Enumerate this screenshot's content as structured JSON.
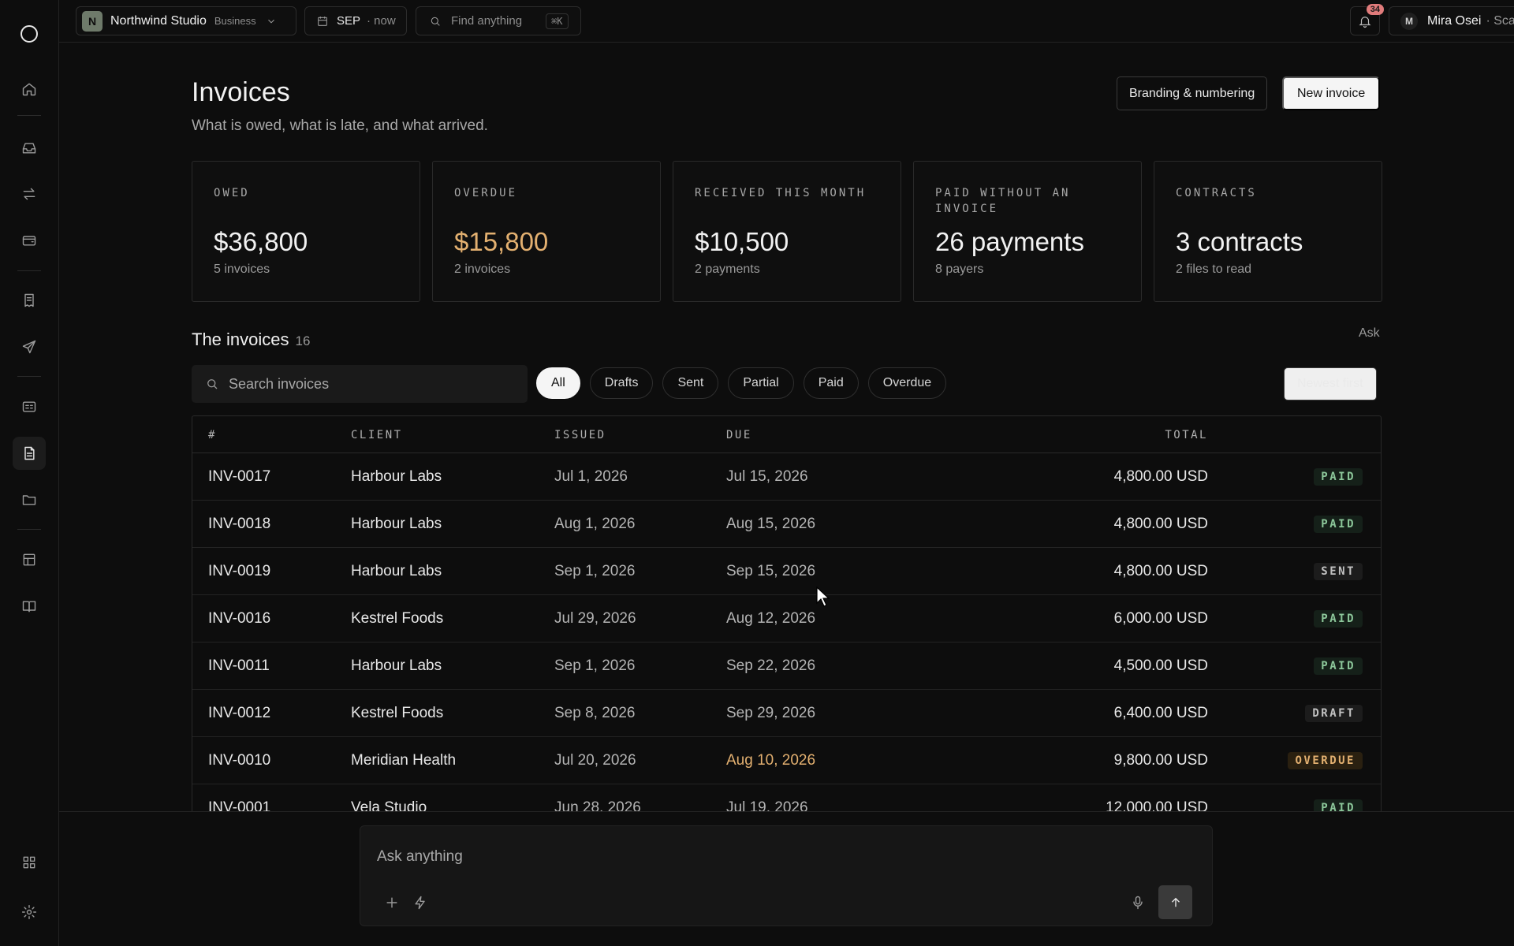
{
  "workspace": {
    "initial": "N",
    "name": "Northwind Studio",
    "plan": "Business"
  },
  "period": {
    "label": "SEP",
    "sub": "· now"
  },
  "find": {
    "placeholder": "Find anything",
    "shortcut": "⌘K"
  },
  "notifications": {
    "count": "34"
  },
  "user": {
    "initial": "M",
    "name": "Mira Osei",
    "plan": "· Scale"
  },
  "page": {
    "title": "Invoices",
    "subtitle": "What is owed, what is late, and what arrived."
  },
  "actions": {
    "branding_label": "Branding & numbering",
    "new_label": "New invoice"
  },
  "stats": [
    {
      "label": "OWED",
      "value": "$36,800",
      "sub": "5 invoices"
    },
    {
      "label": "OVERDUE",
      "value": "$15,800",
      "sub": "2 invoices"
    },
    {
      "label": "RECEIVED THIS MONTH",
      "value": "$10,500",
      "sub": "2 payments"
    },
    {
      "label": "PAID WITHOUT AN INVOICE",
      "value": "26 payments",
      "sub": "8 payers"
    },
    {
      "label": "CONTRACTS",
      "value": "3 contracts",
      "sub": "2 files to read"
    }
  ],
  "section": {
    "title": "The invoices",
    "count": "16",
    "ask_label": "Ask"
  },
  "search": {
    "placeholder": "Search invoices"
  },
  "filters": [
    "All",
    "Drafts",
    "Sent",
    "Partial",
    "Paid",
    "Overdue"
  ],
  "sort": {
    "label": "Newest first"
  },
  "table": {
    "headers": {
      "num": "#",
      "client": "CLIENT",
      "issued": "ISSUED",
      "due": "DUE",
      "total": "TOTAL"
    },
    "rows": [
      {
        "num": "INV-0017",
        "client": "Harbour Labs",
        "issued": "Jul 1, 2026",
        "due": "Jul 15, 2026",
        "total": "4,800.00 USD",
        "status": "PAID"
      },
      {
        "num": "INV-0018",
        "client": "Harbour Labs",
        "issued": "Aug 1, 2026",
        "due": "Aug 15, 2026",
        "total": "4,800.00 USD",
        "status": "PAID"
      },
      {
        "num": "INV-0019",
        "client": "Harbour Labs",
        "issued": "Sep 1, 2026",
        "due": "Sep 15, 2026",
        "total": "4,800.00 USD",
        "status": "SENT"
      },
      {
        "num": "INV-0016",
        "client": "Kestrel Foods",
        "issued": "Jul 29, 2026",
        "due": "Aug 12, 2026",
        "total": "6,000.00 USD",
        "status": "PAID"
      },
      {
        "num": "INV-0011",
        "client": "Harbour Labs",
        "issued": "Sep 1, 2026",
        "due": "Sep 22, 2026",
        "total": "4,500.00 USD",
        "status": "PAID"
      },
      {
        "num": "INV-0012",
        "client": "Kestrel Foods",
        "issued": "Sep 8, 2026",
        "due": "Sep 29, 2026",
        "total": "6,400.00 USD",
        "status": "DRAFT"
      },
      {
        "num": "INV-0010",
        "client": "Meridian Health",
        "issued": "Jul 20, 2026",
        "due": "Aug 10, 2026",
        "total": "9,800.00 USD",
        "status": "OVERDUE"
      },
      {
        "num": "INV-0001",
        "client": "Vela Studio",
        "issued": "Jun 28, 2026",
        "due": "Jul 19, 2026",
        "total": "12,000.00 USD",
        "status": "PAID"
      }
    ]
  },
  "ask": {
    "placeholder": "Ask anything"
  },
  "colors": {
    "accent_warning": "#e3b070",
    "paid": "#8cc79a",
    "background": "#0d0d0d"
  }
}
